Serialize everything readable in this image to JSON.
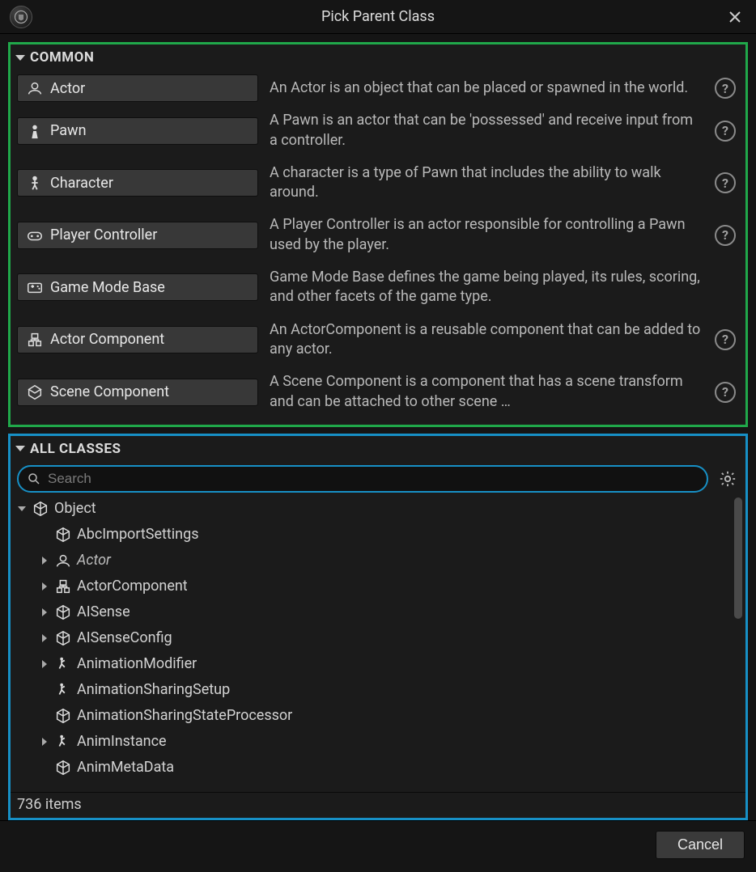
{
  "title": "Pick Parent Class",
  "sections": {
    "common": {
      "label": "COMMON",
      "items": [
        {
          "name": "Actor",
          "desc": "An Actor is an object that can be placed or spawned in the world.",
          "icon": "actor"
        },
        {
          "name": "Pawn",
          "desc": "A Pawn is an actor that can be 'possessed' and receive input from a controller.",
          "icon": "pawn"
        },
        {
          "name": "Character",
          "desc": "A character is a type of Pawn that includes the ability to walk around.",
          "icon": "character"
        },
        {
          "name": "Player Controller",
          "desc": "A Player Controller is an actor responsible for controlling a Pawn used by the player.",
          "icon": "controller"
        },
        {
          "name": "Game Mode Base",
          "desc": "Game Mode Base defines the game being played, its rules, scoring, and other facets of the game type.",
          "icon": "gamemode"
        },
        {
          "name": "Actor Component",
          "desc": "An ActorComponent is a reusable component that can be added to any actor.",
          "icon": "component"
        },
        {
          "name": "Scene Component",
          "desc": "A Scene Component is a component that has a scene transform and can be attached to other scene …",
          "icon": "scenecomp"
        }
      ]
    },
    "all": {
      "label": "ALL CLASSES",
      "search_placeholder": "Search",
      "item_count": "736 items",
      "tree": [
        {
          "name": "Object",
          "icon": "cube",
          "depth": 0,
          "expanded": true,
          "has_children": true
        },
        {
          "name": "AbcImportSettings",
          "icon": "cube",
          "depth": 1,
          "expanded": false,
          "has_children": false
        },
        {
          "name": "Actor",
          "icon": "actor",
          "depth": 1,
          "expanded": false,
          "has_children": true,
          "italic": true
        },
        {
          "name": "ActorComponent",
          "icon": "component",
          "depth": 1,
          "expanded": false,
          "has_children": true
        },
        {
          "name": "AISense",
          "icon": "cube",
          "depth": 1,
          "expanded": false,
          "has_children": true
        },
        {
          "name": "AISenseConfig",
          "icon": "cube",
          "depth": 1,
          "expanded": false,
          "has_children": true
        },
        {
          "name": "AnimationModifier",
          "icon": "anim",
          "depth": 1,
          "expanded": false,
          "has_children": true
        },
        {
          "name": "AnimationSharingSetup",
          "icon": "anim",
          "depth": 1,
          "expanded": false,
          "has_children": false
        },
        {
          "name": "AnimationSharingStateProcessor",
          "icon": "cube",
          "depth": 1,
          "expanded": false,
          "has_children": false
        },
        {
          "name": "AnimInstance",
          "icon": "anim",
          "depth": 1,
          "expanded": false,
          "has_children": true
        },
        {
          "name": "AnimMetaData",
          "icon": "cube",
          "depth": 1,
          "expanded": false,
          "has_children": false
        }
      ]
    }
  },
  "footer": {
    "cancel": "Cancel"
  }
}
